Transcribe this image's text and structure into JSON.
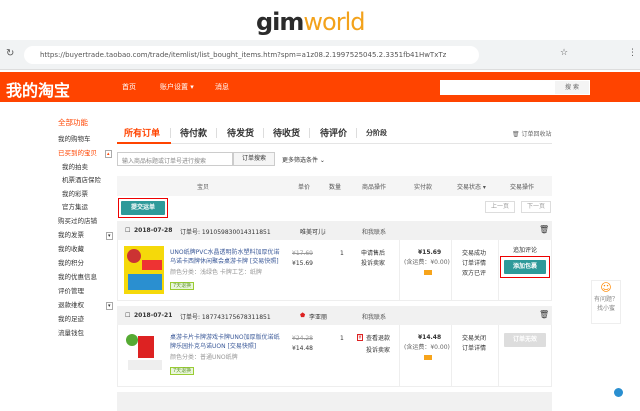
{
  "banner": {
    "logo_a": "gim",
    "logo_b": "world"
  },
  "browser": {
    "url": "https://buyertrade.taobao.com/trade/itemlist/list_bought_items.htm?spm=a1z08.2.1997525045.2.3351fb41HwTxTz"
  },
  "header": {
    "brand": "我的淘宝",
    "nav": [
      "首页",
      "账户设置 ▾",
      "消息"
    ],
    "search_button": "搜 索",
    "color": "#ff4400"
  },
  "sidebar": {
    "items": [
      "全部功能",
      "我的购物车",
      "已买到的宝贝",
      "我的拍卖",
      "机票酒店保险",
      "我的彩票",
      "官方集运",
      "购买过的店铺",
      "我的发票",
      "我的收藏",
      "我的积分",
      "我的优惠信息",
      "评价管理",
      "退款维权",
      "我的足迹",
      "流量钱包"
    ]
  },
  "tabs": {
    "items": [
      "所有订单",
      "待付款",
      "待发货",
      "待收货",
      "待评价",
      "分阶段"
    ],
    "recycle": "订单回收站"
  },
  "search": {
    "placeholder": "输入商品标题或订单号进行搜索",
    "button": "订单搜索",
    "more": "更多筛选条件 ⌄"
  },
  "table": {
    "headers": [
      "宝贝",
      "单价",
      "数量",
      "商品操作",
      "实付款",
      "交易状态 ▾",
      "交易操作"
    ]
  },
  "toolbar": {
    "submit": "提交运单",
    "prev": "上一页",
    "next": "下一页"
  },
  "orders": [
    {
      "date": "2018-07-28",
      "order_no": "订单号: 191059830014311851",
      "shop": "唯美可儿i",
      "contact": "和我联系",
      "title": "UNO纸牌PVC水晶透明防水塑料加厚优诺乌诺卡西牌休闲聚会桌游卡牌 [交易快照]",
      "spec": "颜色分类：浅绿色  卡牌工艺：纸牌",
      "badge": "7天退换",
      "orig_price": "¥17.69",
      "price": "¥15.69",
      "qty": "1",
      "ops": [
        "申请售后",
        "投诉卖家"
      ],
      "paid": "¥15.69",
      "shipping": "(含运费：¥0.00)",
      "status": [
        "交易成功",
        "订单详情",
        "双方已评"
      ],
      "action_link": "追加评论",
      "action_button": "添加包裹"
    },
    {
      "date": "2018-07-21",
      "order_no": "订单号: 187743175678311851",
      "shop": "李亚丽",
      "contact": "和我联系",
      "title": "桌游卡片卡牌游戏卡牌UNO加厚版优诺纸牌乐园扑克乌诺UON [交易快照]",
      "spec": "颜色分类：普通UNO纸牌",
      "badge": "7天退换",
      "orig_price": "¥24.28",
      "price": "¥14.48",
      "qty": "1",
      "ops": [
        "查看退款",
        "投诉卖家"
      ],
      "paid": "¥14.48",
      "shipping": "(含运费：¥0.00)",
      "status": [
        "交易关闭",
        "订单详情"
      ],
      "action_button": "订单无效"
    }
  ],
  "float": {
    "line1": "有问题？",
    "line2": "找小蜜"
  }
}
